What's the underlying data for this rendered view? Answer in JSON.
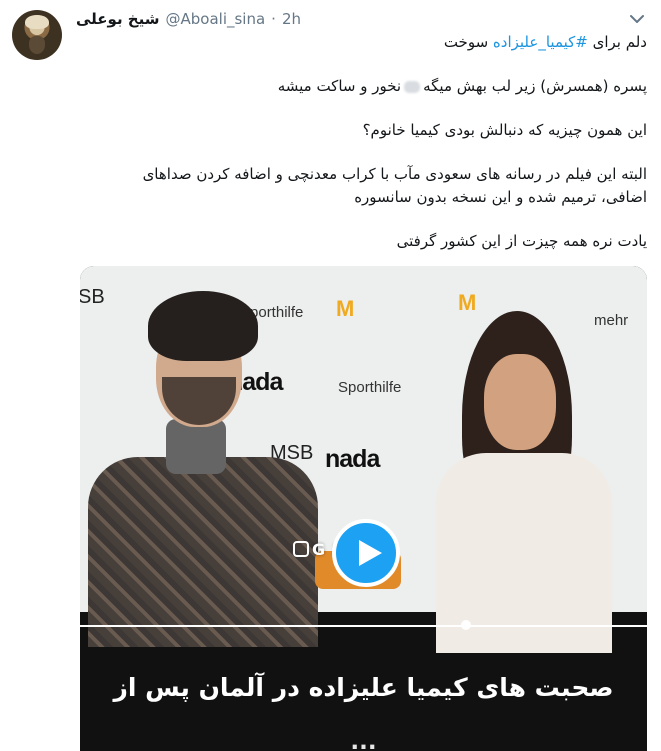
{
  "user": {
    "display_name": "شیخ بوعلی",
    "handle": "@Aboali_sina",
    "separator": "·",
    "time": "2h"
  },
  "tweet": {
    "line1_prefix": "دلم برای ",
    "line1_hashtag": "#کیمیا_علیزاده",
    "line1_suffix": " سوخت",
    "line2_part1": "پسره (همسرش) زیر لب بهش میگه",
    "line2_part2": "نخور و ساکت میشه",
    "line3": "این همون چیزیه که دنبالش بودی کیمیا خانوم؟",
    "line4": "البته این فیلم در رسانه های سعودی مآب با کراب معدنچی و اضافه کردن صداهای",
    "line5": "اضافی، ترمیم شده و این نسخه بدون سانسوره",
    "line6": "یادت نره همه چیزت از این کشور گرفتی"
  },
  "video": {
    "watermark": "G  NEWS",
    "caption_line1": "صحبت های کیمیا علیزاده در آلمان پس از",
    "caption_line2": "...",
    "logos": {
      "msb": "SB",
      "sporthilfe": "Sporthilfe",
      "nada": "nada",
      "msb2": "MSB",
      "mehr": "mehr"
    },
    "progress": 0.72
  },
  "icons": {
    "menu": "chevron-down-icon",
    "play": "play-icon"
  }
}
